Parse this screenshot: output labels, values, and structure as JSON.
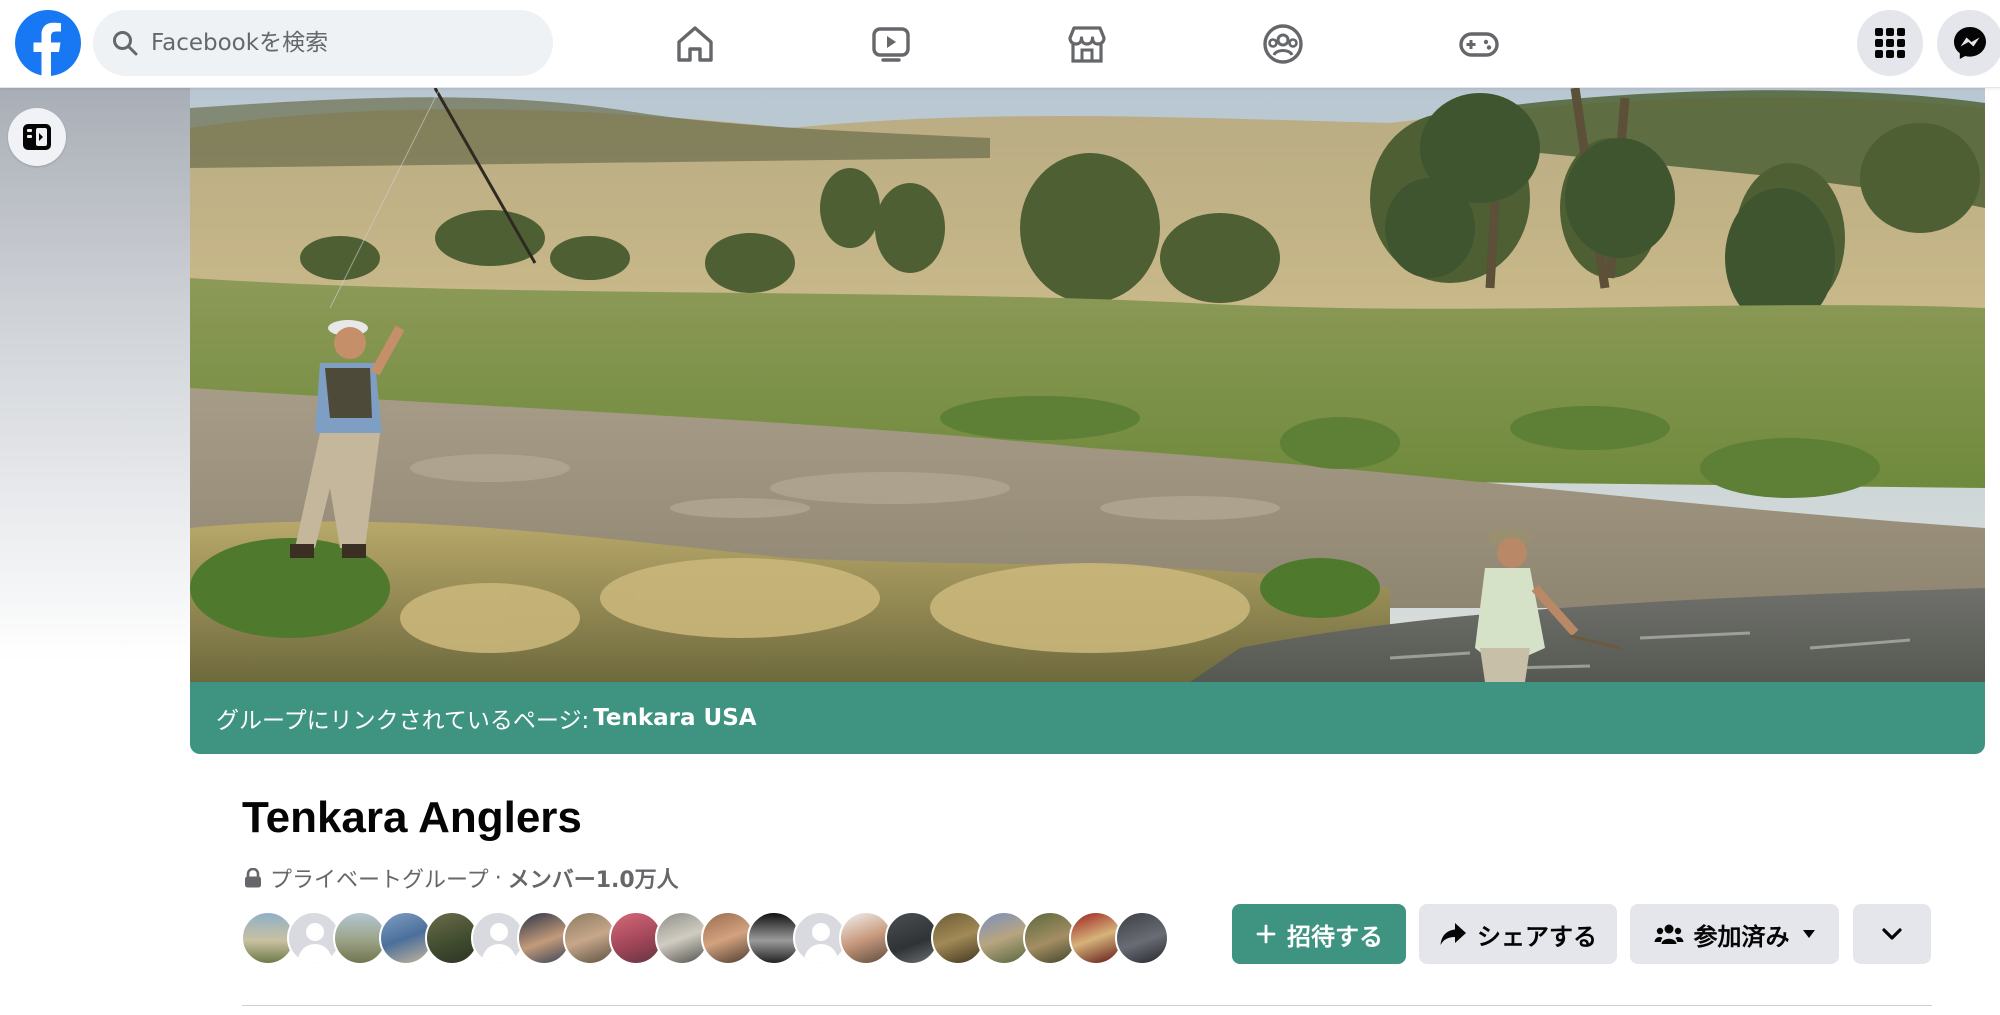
{
  "topbar": {
    "logo_icon": "facebook-logo",
    "search_placeholder": "Facebookを検索",
    "nav_icons": [
      "home-icon",
      "watch-icon",
      "marketplace-icon",
      "groups-icon",
      "gaming-icon"
    ],
    "right_icons": [
      "menu-grid-icon",
      "messenger-icon"
    ]
  },
  "colors": {
    "brand": "#1877f2",
    "group_accent": "#3f9481",
    "button_gray": "#e4e6eb"
  },
  "cover": {
    "linked_prefix": "グループにリンクされているページ:",
    "linked_page": "Tenkara USA"
  },
  "group": {
    "name": "Tenkara Anglers",
    "privacy": "プライベートグループ",
    "separator": "·",
    "members": "メンバー1.0万人",
    "member_avatar_count": 20
  },
  "actions": {
    "invite_label": "招待する",
    "share_label": "シェアする",
    "joined_label": "参加済み",
    "more_icon": "chevron-down-icon"
  }
}
